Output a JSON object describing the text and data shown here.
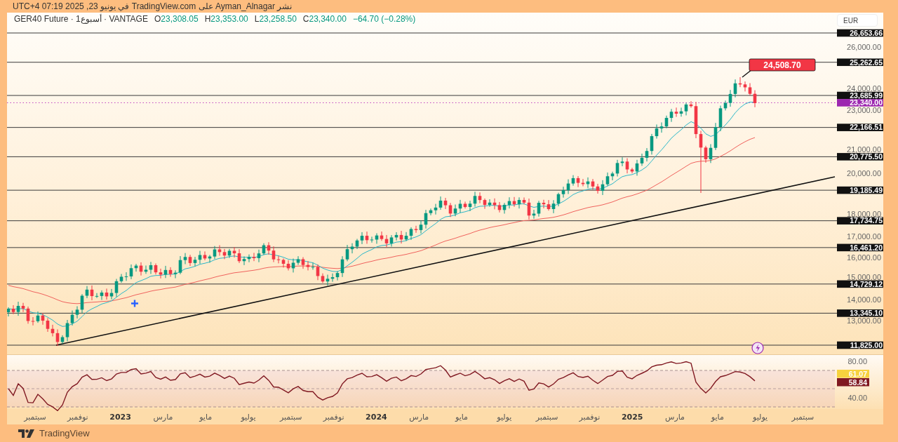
{
  "publish_line": "نشر Ayman_Alnagar على TradingView.com في يونيو 23, 2025 07:19 UTC+4",
  "legend": {
    "symbol": "GER40 Future · 1أسبوع · VANTAGE",
    "open": {
      "letter": "O",
      "value": "23,308.05"
    },
    "high": {
      "letter": "H",
      "value": "23,353.00"
    },
    "low": {
      "letter": "L",
      "value": "23,258.50"
    },
    "close": {
      "letter": "C",
      "value": "23,340.00"
    },
    "change": "−64.70 (−0.28%)"
  },
  "currency": "EUR",
  "price_axis": {
    "ticks": [
      "26,000.00",
      "24,000.00",
      "23,000.00",
      "21,000.00",
      "20,000.00",
      "18,000.00",
      "17,000.00",
      "16,000.00",
      "15,000.00",
      "14,000.00",
      "13,000.00"
    ]
  },
  "levels": [
    {
      "label": "26,653.66",
      "kind": "line"
    },
    {
      "label": "25,262.65",
      "kind": "line"
    },
    {
      "label": "23,685.99",
      "kind": "line"
    },
    {
      "label": "23,340.00",
      "kind": "last-price"
    },
    {
      "label": "22,166.51",
      "kind": "line"
    },
    {
      "label": "20,775.50",
      "kind": "line"
    },
    {
      "label": "19,185.49",
      "kind": "line"
    },
    {
      "label": "17,734.75",
      "kind": "line"
    },
    {
      "label": "16,461.20",
      "kind": "line"
    },
    {
      "label": "14,729.12",
      "kind": "line"
    },
    {
      "label": "13,345.10",
      "kind": "line"
    },
    {
      "label": "11,825.00",
      "kind": "line"
    }
  ],
  "callout": {
    "label": "24,508.70"
  },
  "rsi": {
    "ticks": [
      "80.00",
      "40.00"
    ],
    "values": [
      {
        "label": "61.07",
        "color": "#f7d23e"
      },
      {
        "label": "58.84",
        "color": "#801922"
      }
    ]
  },
  "time_axis": [
    {
      "label": "سبتمبر",
      "kind": "month"
    },
    {
      "label": "يوليو",
      "kind": "month"
    },
    {
      "label": "مايو",
      "kind": "month"
    },
    {
      "label": "مارس",
      "kind": "month"
    },
    {
      "label": "2025",
      "kind": "year"
    },
    {
      "label": "نوفمبر",
      "kind": "month"
    },
    {
      "label": "سبتمبر",
      "kind": "month"
    },
    {
      "label": "يوليو",
      "kind": "month"
    },
    {
      "label": "مايو",
      "kind": "month"
    },
    {
      "label": "مارس",
      "kind": "month"
    },
    {
      "label": "2024",
      "kind": "year"
    },
    {
      "label": "نوفمبر",
      "kind": "month"
    },
    {
      "label": "سبتمبر",
      "kind": "month"
    },
    {
      "label": "يوليو",
      "kind": "month"
    },
    {
      "label": "مايو",
      "kind": "month"
    },
    {
      "label": "مارس",
      "kind": "month"
    },
    {
      "label": "2023",
      "kind": "year"
    },
    {
      "label": "نوفمبر",
      "kind": "month"
    },
    {
      "label": "سبتمبر",
      "kind": "month"
    }
  ],
  "footer": {
    "brand": "TradingView"
  }
}
